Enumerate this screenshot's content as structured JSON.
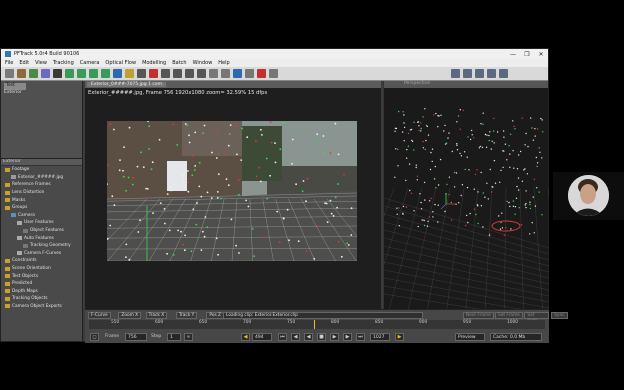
{
  "window": {
    "title": "PFTrack 5.0r4 Build 90106",
    "controls": [
      "—",
      "❐",
      "✕"
    ]
  },
  "menu": [
    "File",
    "Edit",
    "View",
    "Tracking",
    "Camera",
    "Optical Flow",
    "Modelling",
    "Batch",
    "Window",
    "Help"
  ],
  "tool_panel": {
    "tab_label": "Test",
    "sub_label": "Exterior"
  },
  "tree": {
    "header": "Exterior",
    "nodes": [
      {
        "label": "Footage",
        "depth": 0,
        "color": "#c9a227"
      },
      {
        "label": "Exterior_#####.jpg",
        "depth": 1,
        "color": "#9a9a9a"
      },
      {
        "label": "Reference Frames",
        "depth": 0,
        "color": "#c9a227"
      },
      {
        "label": "Lens Distortion",
        "depth": 0,
        "color": "#c9a227"
      },
      {
        "label": "Masks",
        "depth": 0,
        "color": "#c9a227"
      },
      {
        "label": "Groups",
        "depth": 0,
        "color": "#c9a227"
      },
      {
        "label": "Camera",
        "depth": 1,
        "color": "#5a8fc4"
      },
      {
        "label": "User Features",
        "depth": 2,
        "color": "#aaaaaa"
      },
      {
        "label": "Object Features",
        "depth": 3,
        "color": "#777777"
      },
      {
        "label": "Auto Features",
        "depth": 2,
        "color": "#aaaaaa"
      },
      {
        "label": "Tracking Geometry",
        "depth": 3,
        "color": "#777777"
      },
      {
        "label": "Camera F-Curves",
        "depth": 2,
        "color": "#aaaaaa"
      },
      {
        "label": "Constraints",
        "depth": 0,
        "color": "#c9a227"
      },
      {
        "label": "Scene Orientation",
        "depth": 0,
        "color": "#c9a227"
      },
      {
        "label": "Test Objects",
        "depth": 0,
        "color": "#c9a227"
      },
      {
        "label": "Predicted",
        "depth": 0,
        "color": "#c9a227"
      },
      {
        "label": "Depth Maps",
        "depth": 0,
        "color": "#c9a227"
      },
      {
        "label": "Tracking Objects",
        "depth": 0,
        "color": "#c9a227"
      },
      {
        "label": "Camera Object Exports",
        "depth": 0,
        "color": "#c9a227"
      }
    ]
  },
  "viewer": {
    "tab": "Exterior_0###-7075.jpg 1 cam",
    "info": "Exterior_#####.jpg, Frame 756  1920x1080  zoom= 32.59%  15 dfps"
  },
  "right_panel": {
    "header": "Perspective"
  },
  "curve_buttons": [
    "F-Curve",
    "Zoom X",
    "Track X",
    "Track Y",
    "Pos Z",
    "Cam X"
  ],
  "status": "Loading clip: Exterior.Exterior.clip",
  "status_right": [
    "Next Frame",
    "Set Frame",
    "Set Data",
    "Sync"
  ],
  "ruler": {
    "ticks": [
      "550",
      "600",
      "650",
      "700",
      "750",
      "800",
      "850",
      "900",
      "950",
      "1000"
    ],
    "current_frame": 756
  },
  "transport": {
    "frame_label": "Frame",
    "frame_value": "756",
    "step_label": "Step",
    "step_value": "1",
    "start_value": "494",
    "end_value": "1027",
    "preview": "Preview",
    "cache": "Cache: 0.0 Mb"
  },
  "colors": {
    "accent": "#2a7ab8",
    "tracker_green": "#32e048",
    "tracker_red": "#e03a3a",
    "tracker_white": "#f0f0f0"
  }
}
